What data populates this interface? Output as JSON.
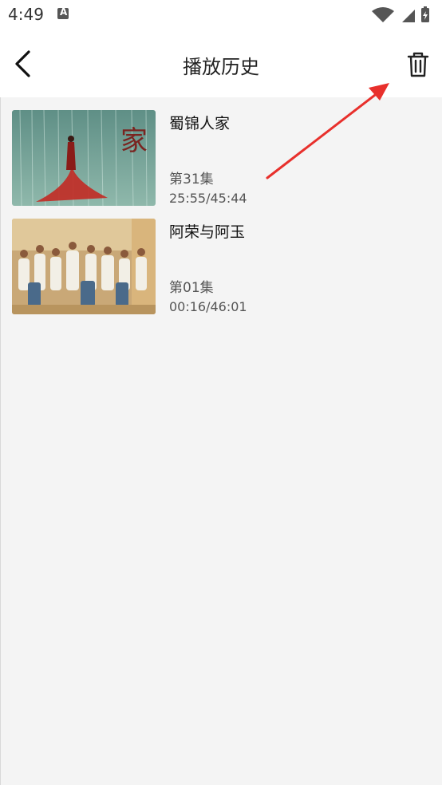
{
  "status_bar": {
    "time": "4:49",
    "notification_icon": "a-icon",
    "notification_letter": "A",
    "right_icons": [
      "wifi-icon",
      "signal-icon",
      "battery-icon"
    ]
  },
  "header": {
    "back_icon": "chevron-left-icon",
    "title": "播放历史",
    "trash_icon": "trash-icon"
  },
  "history": [
    {
      "title": "蜀锦人家",
      "episode": "第31集",
      "progress": "25:55/45:44",
      "poster_text": "家"
    },
    {
      "title": "阿荣与阿玉",
      "episode": "第01集",
      "progress": "00:16/46:01"
    }
  ],
  "annotation": {
    "arrow_color": "#e8302c",
    "arrow_target": "trash-icon"
  },
  "colors": {
    "background": "#f4f4f4",
    "header_bg": "#ffffff",
    "title_text": "#222222",
    "secondary_text": "#555555"
  }
}
